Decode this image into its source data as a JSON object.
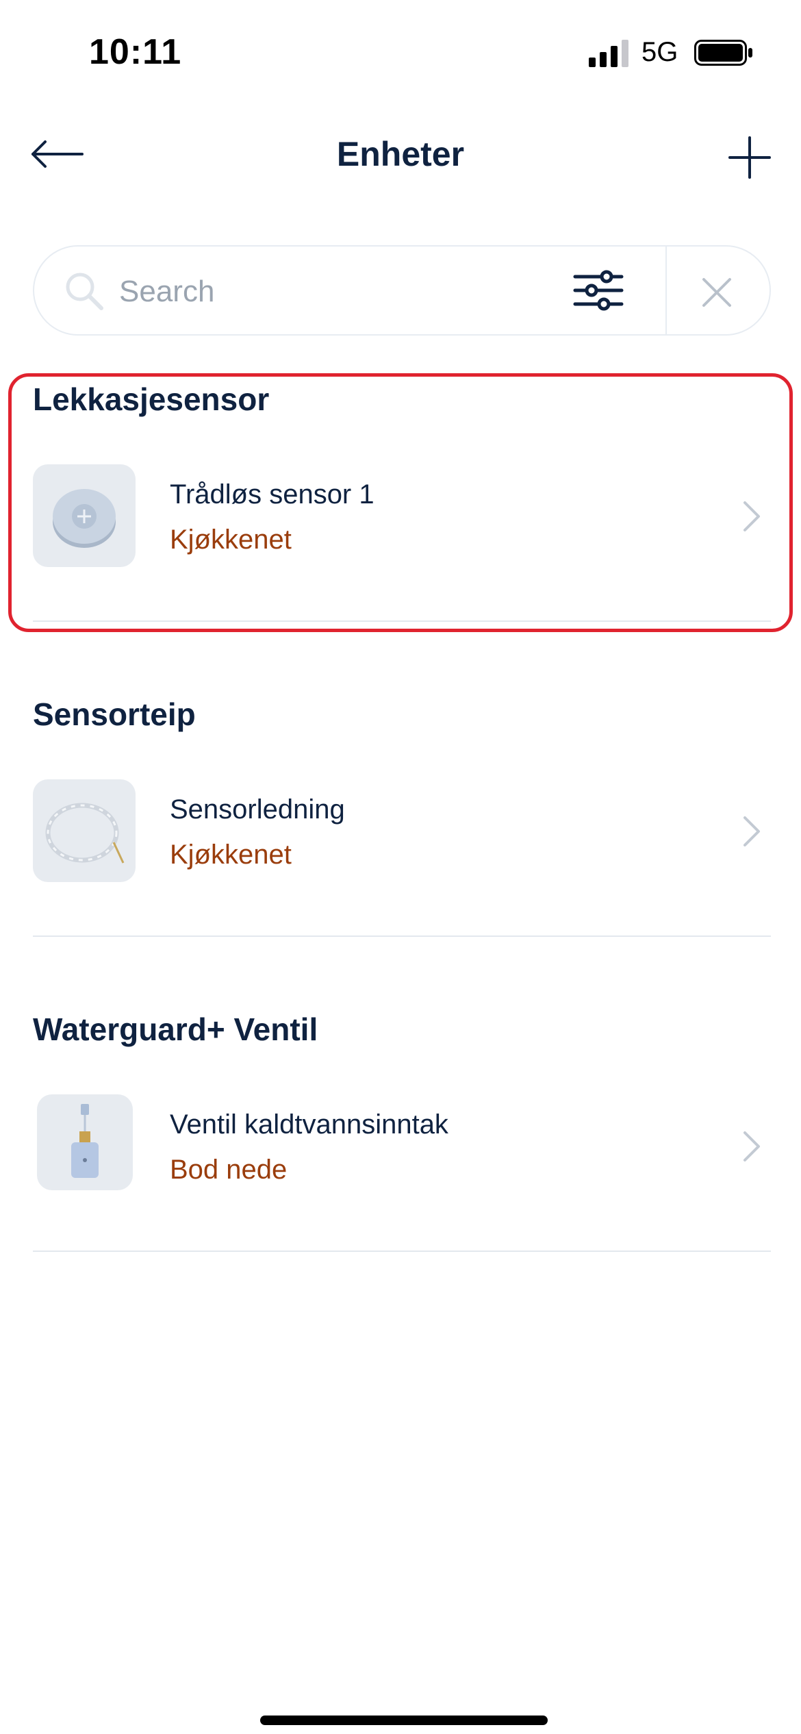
{
  "status_bar": {
    "time": "10:11",
    "network": "5G"
  },
  "header": {
    "title": "Enheter"
  },
  "search": {
    "placeholder": "Search"
  },
  "sections": [
    {
      "title": "Lekkasjesensor",
      "device": {
        "name": "Trådløs sensor 1",
        "location": "Kjøkkenet"
      }
    },
    {
      "title": "Sensorteip",
      "device": {
        "name": "Sensorledning",
        "location": "Kjøkkenet"
      }
    },
    {
      "title": "Waterguard+ Ventil",
      "device": {
        "name": "Ventil kaldtvannsinntak",
        "location": "Bod nede"
      }
    }
  ],
  "colors": {
    "text": "#0f2240",
    "location": "#9a3d0c",
    "highlight": "#e0232f"
  },
  "icons": [
    "back-arrow-icon",
    "plus-icon",
    "search-icon",
    "filter-icon",
    "close-icon",
    "chevron-right-icon"
  ]
}
